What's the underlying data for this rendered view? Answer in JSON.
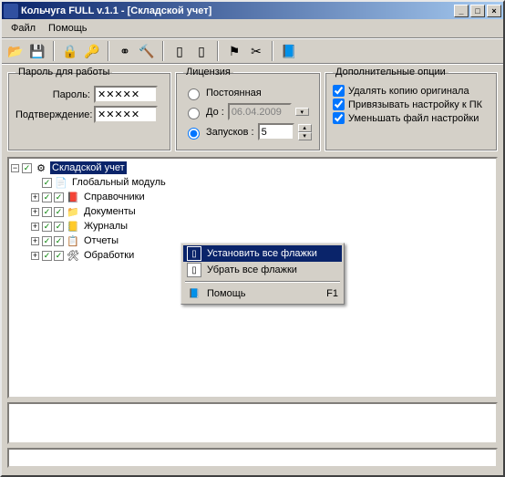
{
  "title": "Кольчуга FULL v.1.1 - [Складской учет]",
  "menu": {
    "file": "Файл",
    "help": "Помощь"
  },
  "groups": {
    "password": {
      "legend": "Пароль для работы",
      "pwd_label": "Пароль:",
      "confirm_label": "Подтверждение:",
      "pwd_value": "✕✕✕✕✕",
      "confirm_value": "✕✕✕✕✕"
    },
    "license": {
      "legend": "Лицензия",
      "permanent": "Постоянная",
      "until": "До :",
      "until_value": "06.04.2009",
      "runs": "Запусков :",
      "runs_value": "5"
    },
    "options": {
      "legend": "Дополнительные опции",
      "opt1": "Удалять копию оригинала",
      "opt2": "Привязывать настройку к ПК",
      "opt3": "Уменьшать файл настройки"
    }
  },
  "tree": {
    "root": "Складской учет",
    "n1": "Глобальный модуль",
    "n2": "Справочники",
    "n3": "Документы",
    "n4": "Журналы",
    "n5": "Отчеты",
    "n6": "Обработки"
  },
  "contextmenu": {
    "set_all": "Установить все флажки",
    "clear_all": "Убрать все флажки",
    "help": "Помощь",
    "help_key": "F1"
  }
}
